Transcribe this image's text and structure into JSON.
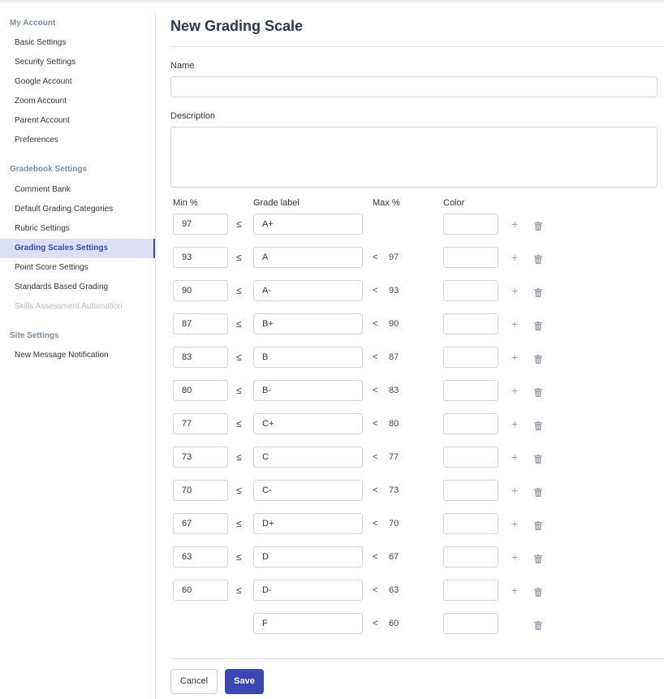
{
  "sidebar": {
    "sections": [
      {
        "title": "My Account",
        "items": [
          {
            "label": "Basic Settings"
          },
          {
            "label": "Security Settings"
          },
          {
            "label": "Google Account"
          },
          {
            "label": "Zoom Account"
          },
          {
            "label": "Parent Account"
          },
          {
            "label": "Preferences"
          }
        ]
      },
      {
        "title": "Gradebook Settings",
        "items": [
          {
            "label": "Comment Bank"
          },
          {
            "label": "Default Grading Categories"
          },
          {
            "label": "Rubric Settings"
          },
          {
            "label": "Grading Scales Settings",
            "active": true
          },
          {
            "label": "Point Score Settings"
          },
          {
            "label": "Standards Based Grading"
          },
          {
            "label": "Skills Assessment Automation",
            "disabled": true
          }
        ]
      },
      {
        "title": "Site Settings",
        "items": [
          {
            "label": "New Message Notification"
          }
        ]
      }
    ]
  },
  "main": {
    "title": "New Grading Scale",
    "name_label": "Name",
    "name_value": "",
    "description_label": "Description",
    "description_value": "",
    "columns": {
      "min": "Min %",
      "grade": "Grade label",
      "max": "Max %",
      "color": "Color"
    },
    "leq_symbol": "≤",
    "lt_symbol": "<",
    "rows": [
      {
        "min": "97",
        "grade": "A+",
        "max": ""
      },
      {
        "min": "93",
        "grade": "A",
        "max": "97"
      },
      {
        "min": "90",
        "grade": "A-",
        "max": "93"
      },
      {
        "min": "87",
        "grade": "B+",
        "max": "90"
      },
      {
        "min": "83",
        "grade": "B",
        "max": "87"
      },
      {
        "min": "80",
        "grade": "B-",
        "max": "83"
      },
      {
        "min": "77",
        "grade": "C+",
        "max": "80"
      },
      {
        "min": "73",
        "grade": "C",
        "max": "77"
      },
      {
        "min": "70",
        "grade": "C-",
        "max": "73"
      },
      {
        "min": "67",
        "grade": "D+",
        "max": "70"
      },
      {
        "min": "63",
        "grade": "D",
        "max": "67"
      },
      {
        "min": "60",
        "grade": "D-",
        "max": "63"
      },
      {
        "min": null,
        "grade": "F",
        "max": "60"
      }
    ],
    "cancel_label": "Cancel",
    "save_label": "Save"
  },
  "colors": {
    "accent": "#3b47b7",
    "active_bg": "#dcdff5",
    "section_title": "#7b8ba0"
  },
  "icons": {
    "add": "plus-icon",
    "delete": "trash-icon"
  }
}
